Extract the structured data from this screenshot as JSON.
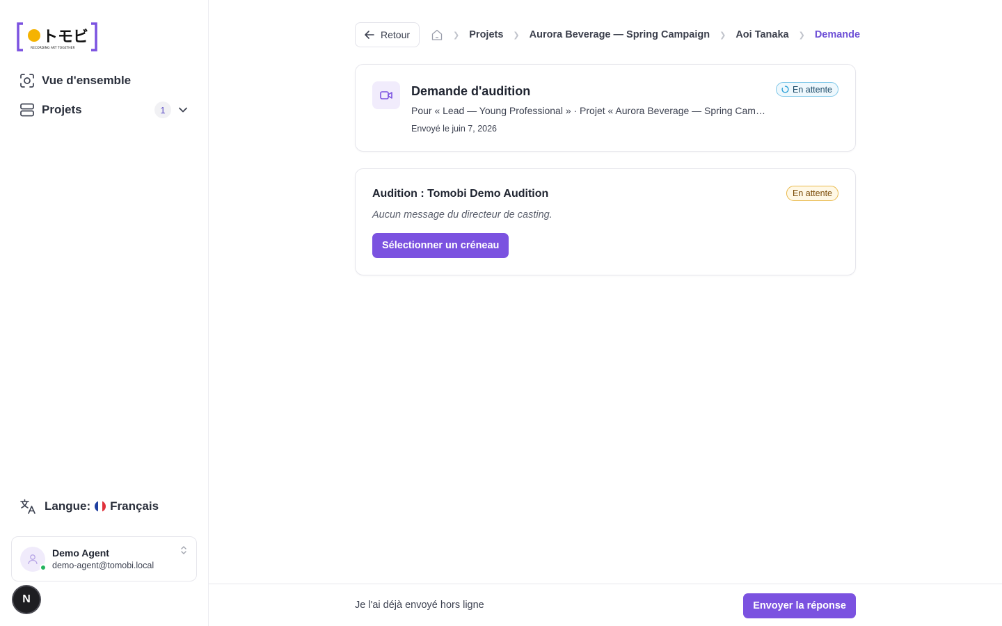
{
  "brand": {
    "logo_text": "トモビ",
    "tagline": "RECORDING ART TOGETHER",
    "accent": "#7b52e0",
    "logo_dot": "#f5b301"
  },
  "sidebar": {
    "items": [
      {
        "label": "Vue d'ensemble",
        "icon": "overview-scan-icon"
      },
      {
        "label": "Projets",
        "icon": "projects-stack-icon",
        "count": "1"
      }
    ],
    "language": {
      "label": "Langue:",
      "value": "Français",
      "icon": "translate-icon",
      "flag_colors": [
        "#1f3fa0",
        "#ffffff",
        "#e0313b"
      ]
    },
    "user": {
      "name": "Demo Agent",
      "email": "demo-agent@tomobi.local",
      "status_color": "#22b35e"
    },
    "dev_badge": "N"
  },
  "topbar": {
    "back_label": "Retour",
    "breadcrumbs": [
      "Projets",
      "Aurora Beverage — Spring Campaign",
      "Aoi Tanaka",
      "Demande"
    ]
  },
  "request_card": {
    "title": "Demande d'audition",
    "subtitle": "Pour « Lead — Young Professional » · Projet « Aurora Beverage — Spring Campaign »",
    "date": "Envoyé le juin 7, 2026",
    "status": "En attente"
  },
  "audition_card": {
    "title": "Audition : Tomobi Demo Audition",
    "message": "Aucun message du directeur de casting.",
    "status": "En attente",
    "button_label": "Sélectionner un créneau"
  },
  "footer": {
    "offline_label": "Je l'ai déjà envoyé hors ligne",
    "send_label": "Envoyer la réponse"
  }
}
